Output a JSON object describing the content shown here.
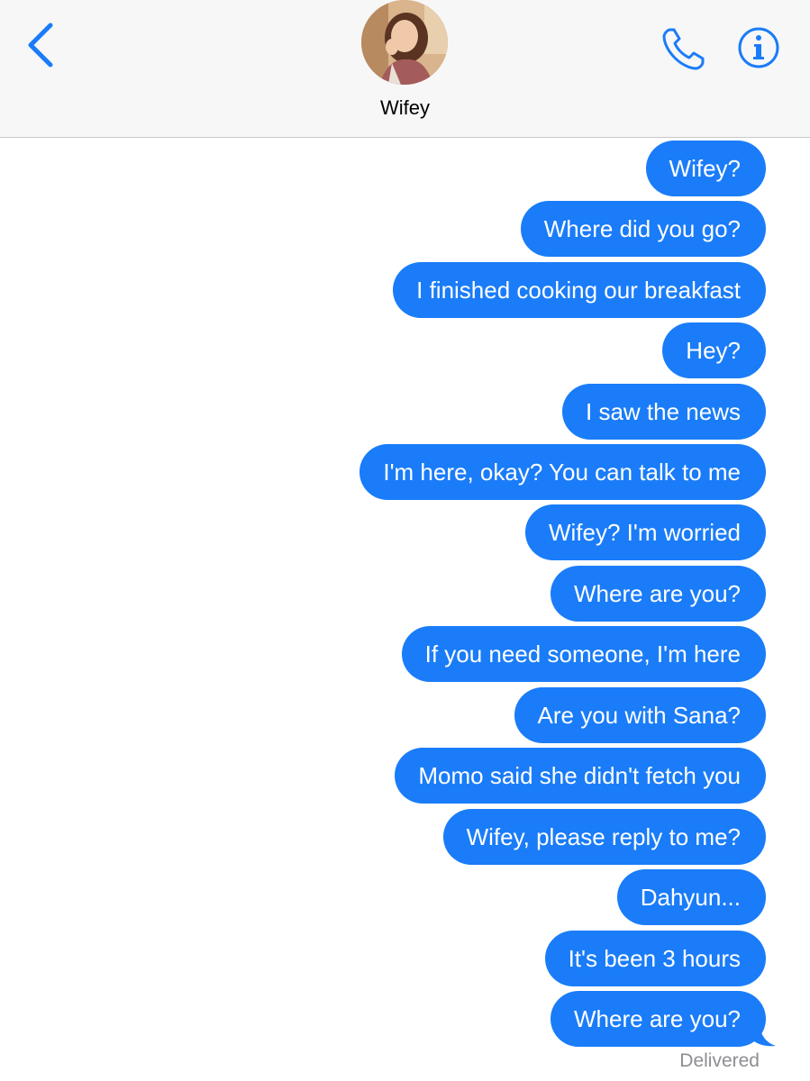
{
  "header": {
    "contact_name": "Wifey",
    "back_icon": "chevron-left-icon",
    "call_icon": "phone-icon",
    "info_icon": "info-icon",
    "accent_color": "#1a7cf8"
  },
  "messages": [
    {
      "text": "Wifey?"
    },
    {
      "text": "Where did you go?"
    },
    {
      "text": "I finished cooking our breakfast"
    },
    {
      "text": "Hey?"
    },
    {
      "text": "I saw the news"
    },
    {
      "text": "I'm here, okay? You can talk to me"
    },
    {
      "text": "Wifey? I'm worried"
    },
    {
      "text": "Where are you?"
    },
    {
      "text": "If you need someone, I'm here"
    },
    {
      "text": "Are you with Sana?"
    },
    {
      "text": "Momo said she didn't fetch you"
    },
    {
      "text": "Wifey, please reply to me?"
    },
    {
      "text": "Dahyun..."
    },
    {
      "text": "It's been 3 hours"
    },
    {
      "text": "Where are you?"
    }
  ],
  "status": {
    "delivered_label": "Delivered"
  },
  "colors": {
    "bubble": "#1a7cf8",
    "bubble_text": "#ffffff",
    "header_bg": "#f7f7f8",
    "status_text": "#8e8e93"
  }
}
